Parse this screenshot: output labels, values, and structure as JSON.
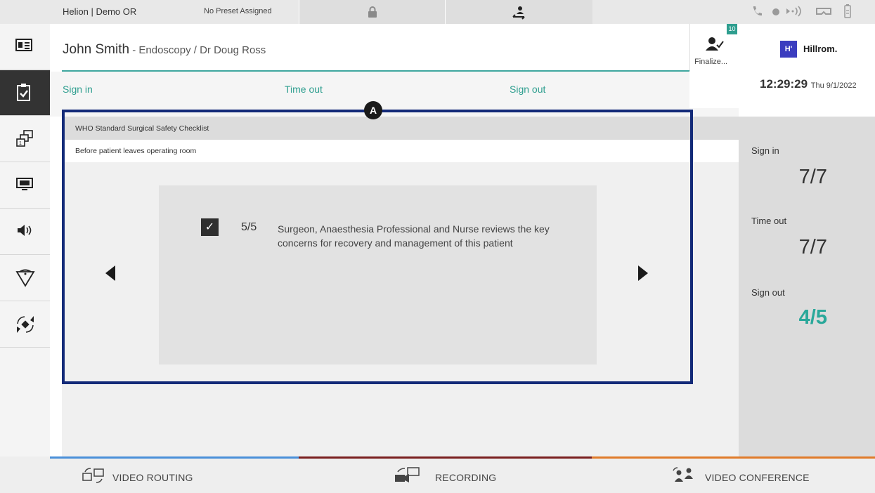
{
  "topbar": {
    "room": "Helion | Demo OR",
    "preset": "No Preset Assigned",
    "icons": [
      "lock-icon",
      "transfer-icon",
      "phone-icon",
      "record-dot-icon",
      "broadcast-icon",
      "vr-icon",
      "battery-icon"
    ]
  },
  "rail": {
    "items": [
      "patient-card-icon",
      "checklist-icon",
      "layouts-icon",
      "displays-icon",
      "audio-icon",
      "lights-icon",
      "camera-icon"
    ]
  },
  "header": {
    "patient_name": "John Smith",
    "patient_details": " - Endoscopy / Dr Doug Ross",
    "finalize_label": "Finalize...",
    "finalize_badge": "10"
  },
  "tabs": {
    "sign_in": "Sign in",
    "time_out": "Time out",
    "sign_out": "Sign out"
  },
  "checklist": {
    "title": "WHO Standard Surgical Safety Checklist",
    "phase": "Before patient leaves operating room",
    "checkbox": "✓",
    "counter": "5/5",
    "question": "Surgeon, Anaesthesia Professional and Nurse reviews the key concerns for recovery and management of this patient",
    "callout": "A"
  },
  "right_panel": {
    "logo_mark": "H'",
    "logo_text": "Hillrom.",
    "time": "12:29:29",
    "date": "Thu 9/1/2022",
    "sign_in_label": "Sign in",
    "sign_in_value": "7/7",
    "time_out_label": "Time out",
    "time_out_value": "7/7",
    "sign_out_label": "Sign out",
    "sign_out_value": "4/5",
    "accent_color": "#2aa89a"
  },
  "bottombar": {
    "video_routing": "VIDEO ROUTING",
    "recording": "RECORDING",
    "video_conference": "VIDEO CONFERENCE",
    "colors": {
      "video_routing": "#4a90d9",
      "recording": "#7a1f1f",
      "video_conference": "#e07b2a"
    }
  }
}
